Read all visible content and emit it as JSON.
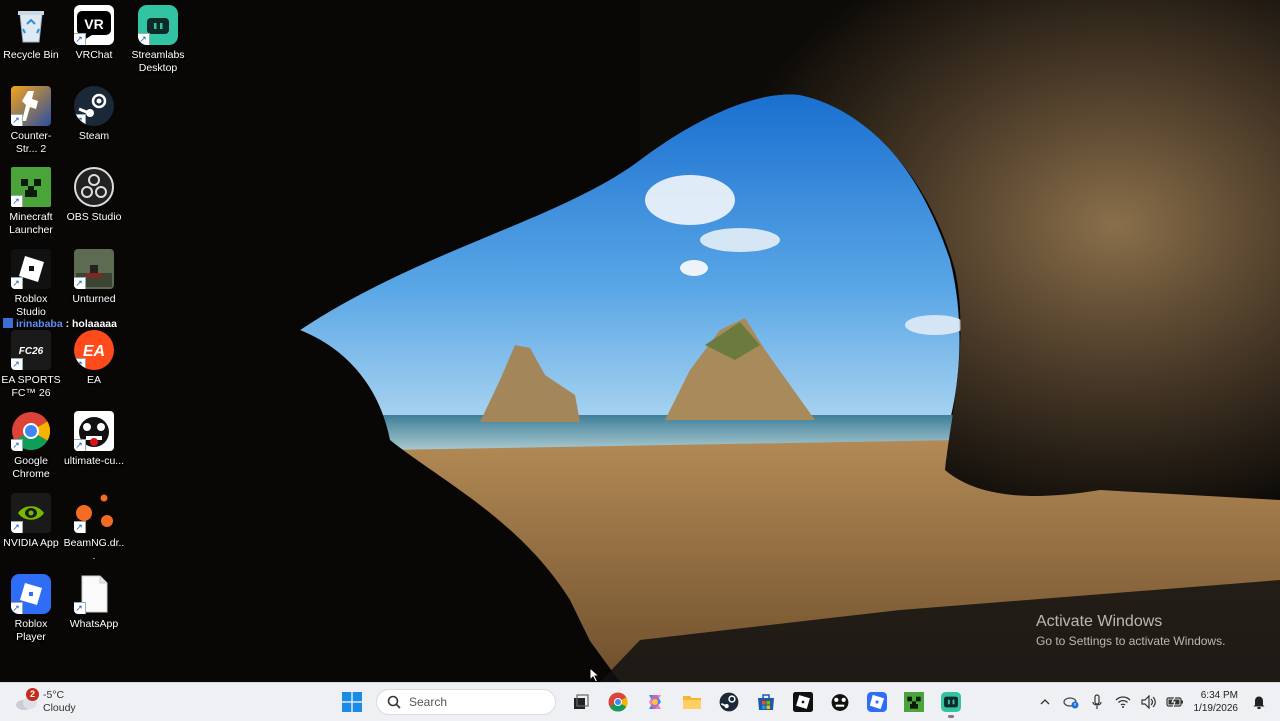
{
  "desktop": {
    "icons": [
      {
        "label": "Recycle Bin",
        "icon": "recycle-bin-icon"
      },
      {
        "label": "VRChat",
        "icon": "vrchat-icon"
      },
      {
        "label": "Streamlabs Desktop",
        "icon": "streamlabs-icon"
      },
      {
        "label": "Counter-Str... 2",
        "icon": "counter-strike-icon"
      },
      {
        "label": "Steam",
        "icon": "steam-icon"
      },
      {
        "label": "Minecraft Launcher",
        "icon": "minecraft-icon"
      },
      {
        "label": "OBS Studio",
        "icon": "obs-icon"
      },
      {
        "label": "Roblox Studio",
        "icon": "roblox-studio-icon"
      },
      {
        "label": "Unturned",
        "icon": "unturned-icon"
      },
      {
        "label": "EA SPORTS FC™ 26",
        "icon": "ea-fc-icon"
      },
      {
        "label": "EA",
        "icon": "ea-icon"
      },
      {
        "label": "Google Chrome",
        "icon": "chrome-icon"
      },
      {
        "label": "ultimate-cu...",
        "icon": "ultimate-custom-icon"
      },
      {
        "label": "NVIDIA App",
        "icon": "nvidia-icon"
      },
      {
        "label": "BeamNG.dr...",
        "icon": "beamng-icon"
      },
      {
        "label": "Roblox Player",
        "icon": "roblox-player-icon"
      },
      {
        "label": "WhatsApp",
        "icon": "file-icon"
      }
    ],
    "chat_overlay": {
      "user": "irinababa",
      "message": ": holaaaaa"
    },
    "watermark": {
      "title": "Activate Windows",
      "subtitle": "Go to Settings to activate Windows."
    }
  },
  "taskbar": {
    "weather": {
      "badge": "2",
      "temp": "-5°C",
      "condition": "Cloudy"
    },
    "search_placeholder": "Search",
    "pinned": [
      "start-icon",
      "search",
      "task-view-icon",
      "chrome-icon",
      "copilot-icon",
      "file-explorer-icon",
      "steam-icon",
      "store-icon",
      "roblox-studio-icon",
      "ultimate-custom-icon",
      "roblox-player-icon",
      "minecraft-icon",
      "streamlabs-icon"
    ],
    "clock": {
      "time": "6:34 PM",
      "date": "1/19/2026"
    }
  }
}
